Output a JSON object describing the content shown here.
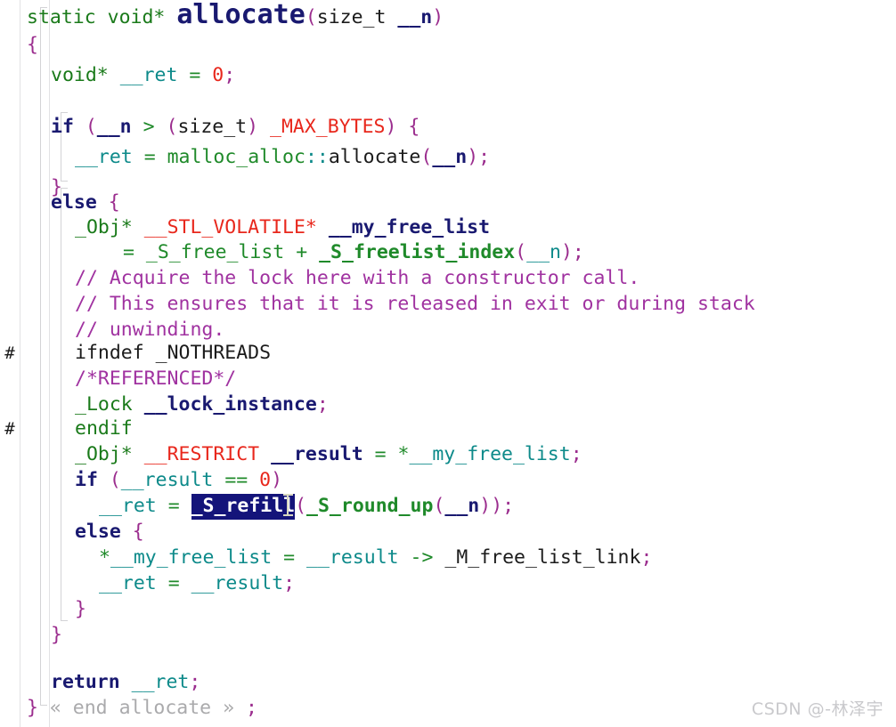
{
  "editor": {
    "language": "cpp",
    "background_color": "#ffffff",
    "gutter_rule_color": "#e2e2e4",
    "selection_background": "#14147a",
    "selection_foreground": "#ffffff",
    "font_size_px": 21.5,
    "line_height_px": 34,
    "preprocessor_marks": [
      "#",
      "#"
    ]
  },
  "colors": {
    "keyword": "#191970",
    "type_green": "#1a7a1a",
    "macro_red": "#e8271c",
    "comment_purple": "#a032a0",
    "punct_purple": "#9b2d8e",
    "teal": "#0d8a8a",
    "plain": "#1b1b1b",
    "fold_grey": "#aaaaac",
    "number_red": "#e8271c"
  },
  "code": {
    "function_name": "allocate",
    "lines": [
      {
        "n": 1,
        "text": "static void* allocate(size_t __n)"
      },
      {
        "n": 2,
        "text": "{"
      },
      {
        "n": 3,
        "text": "  void* __ret = 0;"
      },
      {
        "n": 4,
        "text": ""
      },
      {
        "n": 5,
        "text": "  if (__n > (size_t) _MAX_BYTES) {"
      },
      {
        "n": 6,
        "text": "    __ret = malloc_alloc::allocate(__n);"
      },
      {
        "n": 7,
        "text": "  }"
      },
      {
        "n": 8,
        "text": "  else {"
      },
      {
        "n": 9,
        "text": "    _Obj* __STL_VOLATILE* __my_free_list"
      },
      {
        "n": 10,
        "text": "      = _S_free_list + _S_freelist_index(__n);"
      },
      {
        "n": 11,
        "text": "    // Acquire the lock here with a constructor call."
      },
      {
        "n": 12,
        "text": "    // This ensures that it is released in exit or during stack"
      },
      {
        "n": 13,
        "text": "    // unwinding."
      },
      {
        "n": 14,
        "text": "#   ifndef _NOTHREADS"
      },
      {
        "n": 15,
        "text": "    /*REFERENCED*/"
      },
      {
        "n": 16,
        "text": "    _Lock __lock_instance;"
      },
      {
        "n": 17,
        "text": "#   endif"
      },
      {
        "n": 18,
        "text": "    _Obj* __RESTRICT __result = *__my_free_list;"
      },
      {
        "n": 19,
        "text": "    if (__result == 0)"
      },
      {
        "n": 20,
        "text": "      __ret = _S_refill(_S_round_up(__n));"
      },
      {
        "n": 21,
        "text": "    else {"
      },
      {
        "n": 22,
        "text": "      *__my_free_list = __result -> _M_free_list_link;"
      },
      {
        "n": 23,
        "text": "      __ret = __result;"
      },
      {
        "n": 24,
        "text": "    }"
      },
      {
        "n": 25,
        "text": "  }"
      },
      {
        "n": 26,
        "text": ""
      },
      {
        "n": 27,
        "text": "  return __ret;"
      },
      {
        "n": 28,
        "text": "} « end allocate » ;"
      }
    ],
    "comments": [
      "// Acquire the lock here with a constructor call.",
      "// This ensures that it is released in exit or during stack",
      "// unwinding.",
      "/*REFERENCED*/"
    ],
    "fold_placeholder": "« end allocate »"
  },
  "tokens": {
    "l1": {
      "static": "static",
      "voidstar": "void*",
      "fname": "allocate",
      "lp": "(",
      "sizet": "size_t",
      "arg": "__n",
      "rp": ")"
    },
    "l2": {
      "brace": "{"
    },
    "l3": {
      "voidstar": "void*",
      "ret": "__ret",
      "eq": "=",
      "zero": "0",
      "semi": ";"
    },
    "l5": {
      "if": "if",
      "lp": "(",
      "n": "__n",
      "gt": ">",
      "lp2": "(",
      "sizet": "size_t",
      "rp2": ")",
      "max": "_MAX_BYTES",
      "rp": ")",
      "brace": "{"
    },
    "l6": {
      "ret": "__ret",
      "eq": "=",
      "ns": "malloc_alloc",
      "cc": "::",
      "fn": "allocate",
      "lp": "(",
      "n": "__n",
      "rp": ")",
      "semi": ";"
    },
    "l7": {
      "brace": "}"
    },
    "l8": {
      "else": "else",
      "brace": "{"
    },
    "l9": {
      "obj": "_Obj",
      "star": "*",
      "vol": "__STL_VOLATILE",
      "star2": "*",
      "mfl": "__my_free_list"
    },
    "l10": {
      "eq": "=",
      "sfl": "_S_free_list",
      "plus": "+",
      "idx": "_S_freelist_index",
      "lp": "(",
      "n": "__n",
      "rp": ")",
      "semi": ";"
    },
    "l14": {
      "hash": "#",
      "ifndef": "ifndef",
      "sym": "_NOTHREADS"
    },
    "l16": {
      "lock": "_Lock",
      "inst": "__lock_instance",
      "semi": ";"
    },
    "l17": {
      "hash": "#",
      "endif": "endif"
    },
    "l18": {
      "obj": "_Obj",
      "star": "*",
      "restrict": "__RESTRICT",
      "result": "__result",
      "eq": "=",
      "deref": "*",
      "mfl": "__my_free_list",
      "semi": ";"
    },
    "l19": {
      "if": "if",
      "lp": "(",
      "result": "__result",
      "eqeq": "==",
      "zero": "0",
      "rp": ")"
    },
    "l20": {
      "ret": "__ret",
      "eq": "=",
      "refill": "_S_refill",
      "lp": "(",
      "roundup": "_S_round_up",
      "lp2": "(",
      "n": "__n",
      "rp2": ")",
      "rp": ")",
      "semi": ";"
    },
    "l21": {
      "else": "else",
      "brace": "{"
    },
    "l22": {
      "deref": "*",
      "mfl": "__my_free_list",
      "eq": "=",
      "result": "__result",
      "arrow": "->",
      "link": "_M_free_list_link",
      "semi": ";"
    },
    "l23": {
      "ret": "__ret",
      "eq": "=",
      "result": "__result",
      "semi": ";"
    },
    "l24": {
      "brace": "}"
    },
    "l25": {
      "brace": "}"
    },
    "l27": {
      "return": "return",
      "ret": "__ret",
      "semi": ";"
    },
    "l28": {
      "brace": "}",
      "fold": "« end allocate »",
      "semi": ";"
    }
  },
  "selection": {
    "selected_text": "_S_refill",
    "line": 20,
    "cursor_type": "i-beam"
  },
  "watermark": {
    "text": "CSDN @-林泽宇"
  }
}
